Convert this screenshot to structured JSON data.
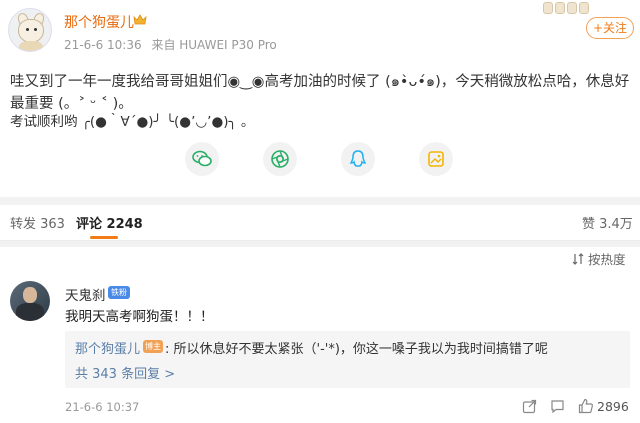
{
  "post": {
    "author": "那个狗蛋儿",
    "date": "21-6-6 10:36",
    "source": "来自 HUAWEI P30 Pro",
    "follow_label": "+关注",
    "text": "哇又到了一年一度我给哥哥姐姐们◉‿◉高考加油的时候了 (๑•̀ᴗ•́๑)，今天稍微放松点哈，休息好最重要 (。˃ ᵕ ˂ )。",
    "text2": "考试顺利哟 ╭(●｀∀´●)╯ ╰(●’◡’●)╮ 。"
  },
  "share_icons": [
    "wechat-icon",
    "moments-icon",
    "qq-icon",
    "qzone-icon"
  ],
  "tabs": {
    "repost": "转发 363",
    "comment": "评论 2248",
    "like": "赞 3.4万"
  },
  "sort_label": "按热度",
  "comment": {
    "author": "天鬼刹",
    "badge": "铁粉",
    "text": "我明天高考啊狗蛋！！！",
    "reply": {
      "author": "那个狗蛋儿",
      "badge": "博主",
      "text": ": 所以休息好不要太紧张（'-'*)，你这一嗓子我以为我时间搞错了呢",
      "more": "共 343 条回复 >"
    },
    "time": "21-6-6 10:37",
    "likes": "2896"
  },
  "colors": {
    "accent": "#f07c1a",
    "link": "#5b7fa8",
    "wechat": "#2aae67",
    "moments": "#2aae67",
    "qq": "#1fb2f0",
    "qzone": "#f4b400"
  }
}
